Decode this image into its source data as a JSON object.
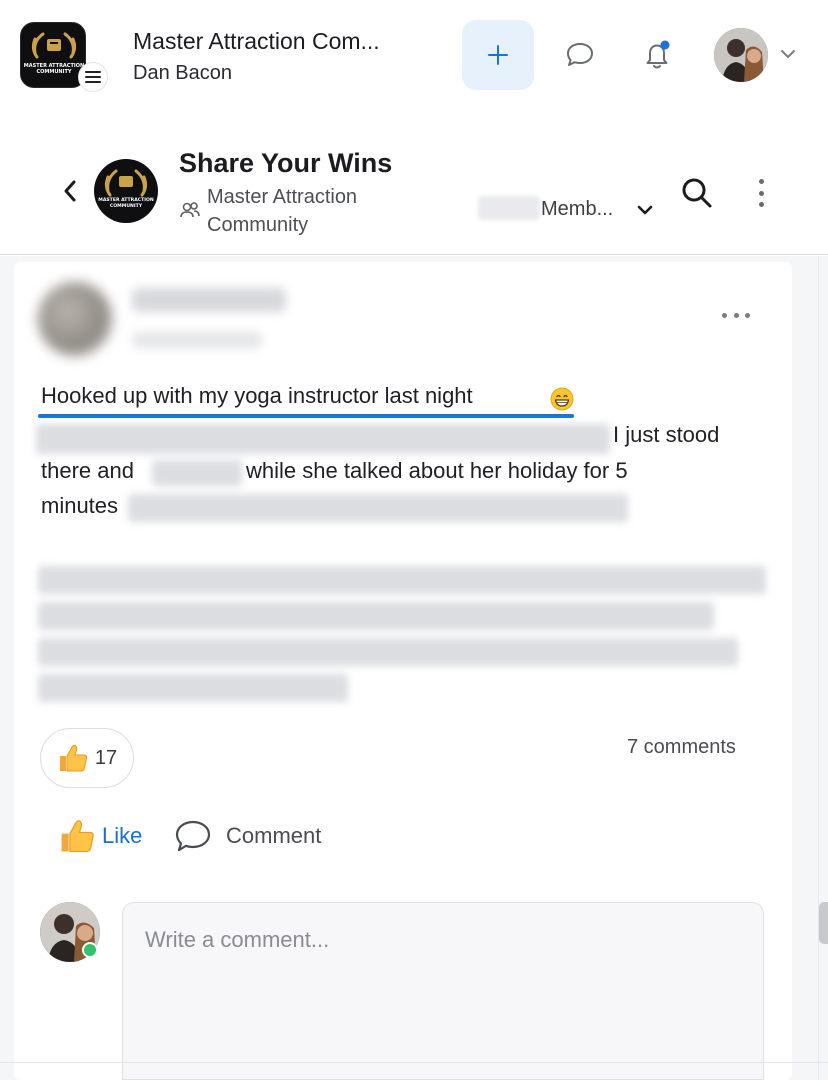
{
  "header": {
    "app_title": "Master Attraction Com...",
    "app_subtitle": "Dan Bacon",
    "logo_text": "MASTER ATTRACTION COMMUNITY",
    "icons": [
      "menu-icon",
      "plus-icon",
      "chat-icon",
      "bell-icon",
      "chevron-down-icon"
    ],
    "accent": "#1a73d9",
    "plus_bg": "#e6f1fc",
    "notification_dot": "#1a73d9"
  },
  "group": {
    "title": "Share Your Wins",
    "community": "Master Attraction Community",
    "members_label": "Memb...",
    "icons": [
      "back-icon",
      "people-icon",
      "search-icon",
      "more-vertical-icon"
    ]
  },
  "post": {
    "title": "Hooked up with my yoga instructor last night",
    "title_emoji": "grinning-face-emoji",
    "line1_tail": "I just stood",
    "line2_a": "there and",
    "line2_b": "while she talked about her holiday for 5",
    "line3": "minutes",
    "reaction_count": "17",
    "comments_label": "7 comments",
    "like_label": "Like",
    "comment_label": "Comment",
    "like_color": "#1a6fd0"
  },
  "composer": {
    "placeholder": "Write a comment...",
    "online_color": "#32c26b"
  }
}
